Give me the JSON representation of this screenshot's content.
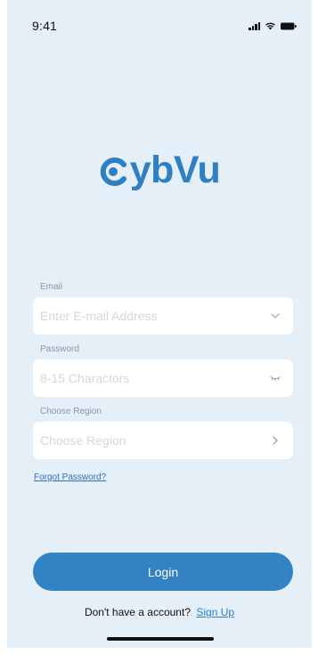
{
  "status_bar": {
    "time": "9:41",
    "icons": [
      "signal-icon",
      "wifi-icon",
      "battery-icon"
    ]
  },
  "logo": {
    "text": "ybVu",
    "full_name": "CybVu",
    "color": "#2f7fc3"
  },
  "form": {
    "email": {
      "label": "Email",
      "placeholder": "Enter E-mail Address",
      "value": "",
      "icon": "chevron-down-icon"
    },
    "password": {
      "label": "Password",
      "placeholder": "8-15 Charactors",
      "value": "",
      "icon": "eye-closed-icon"
    },
    "region": {
      "label": "Choose Region",
      "placeholder": "Choose Region",
      "value": "",
      "icon": "chevron-right-icon"
    },
    "forgot_password": "Forgot Password?"
  },
  "actions": {
    "login_label": "Login",
    "signup_prompt": "Don't have a account?",
    "signup_link": "Sign Up"
  },
  "colors": {
    "background": "#e4eff8",
    "accent": "#3282c4",
    "link": "#2f6fc1"
  }
}
